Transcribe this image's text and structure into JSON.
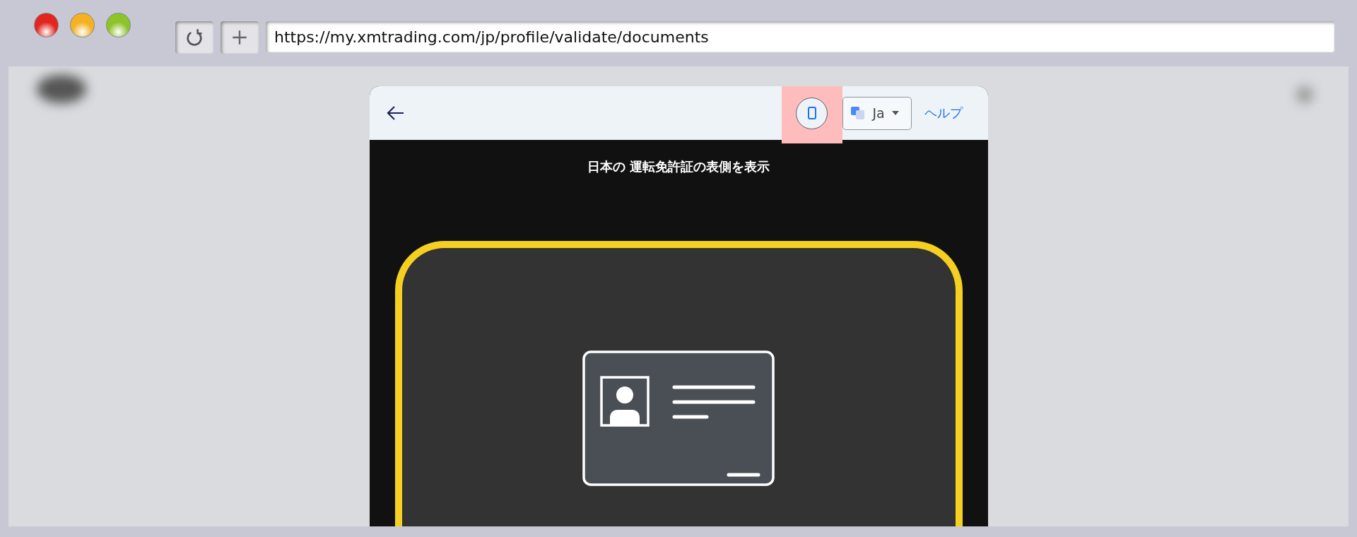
{
  "browser": {
    "window_controls": [
      {
        "color": "#e0261f"
      },
      {
        "color": "#f5b122"
      },
      {
        "color": "#8cc42a"
      }
    ],
    "toolbar_buttons": [
      {
        "kind": "reload"
      },
      {
        "kind": "new-tab"
      }
    ],
    "address": "https://my.xmtrading.com/jp/profile/validate/documents"
  },
  "modal": {
    "phone_button": {
      "highlighted": true
    },
    "language": "Ja",
    "help": "ヘルプ",
    "instruction": "日本の 運転免許証の表側を表示"
  }
}
